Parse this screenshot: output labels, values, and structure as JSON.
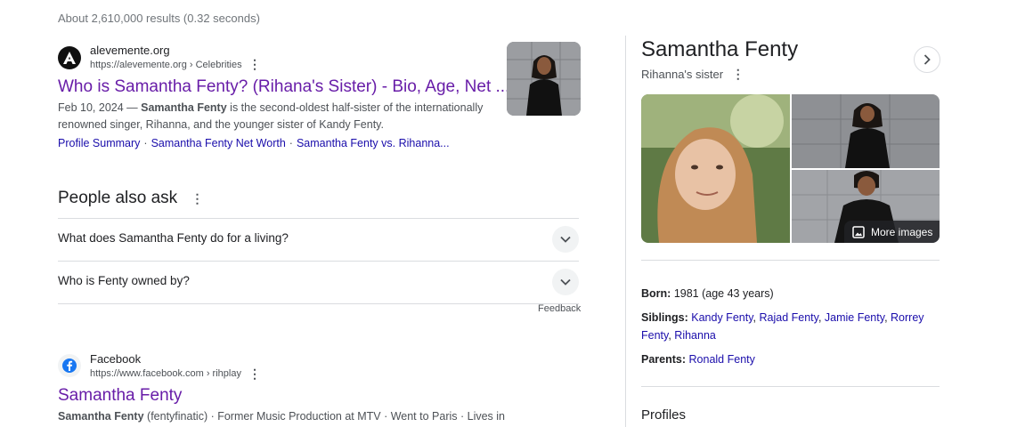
{
  "stats": "About 2,610,000 results (0.32 seconds)",
  "results": [
    {
      "site_name": "alevemente.org",
      "url": "https://alevemente.org › Celebrities",
      "title": "Who is Samantha Fenty? (Rihana's Sister) - Bio, Age, Net ...",
      "snippet_date": "Feb 10, 2024 — ",
      "snippet_bold": "Samantha Fenty",
      "snippet_rest": " is the second-oldest half-sister of the internationally renowned singer, Rihanna, and the younger sister of Kandy Fenty.",
      "sitelinks": [
        "Profile Summary",
        "Samantha Fenty Net Worth",
        "Samantha Fenty vs. Rihanna..."
      ]
    },
    {
      "site_name": "Facebook",
      "url": "https://www.facebook.com › rihplay",
      "title": "Samantha Fenty",
      "snippet_bold": "Samantha Fenty",
      "snippet_rest": " (fentyfinatic) · Former Music Production at MTV · Went to Paris · Lives in"
    }
  ],
  "paa": {
    "title": "People also ask",
    "questions": [
      "What does Samantha Fenty do for a living?",
      "Who is Fenty owned by?"
    ],
    "feedback": "Feedback"
  },
  "knowledge_panel": {
    "title": "Samantha Fenty",
    "subtitle": "Rihanna's sister",
    "more_images": "More images",
    "born_label": "Born:",
    "born_value": "1981 (age 43 years)",
    "siblings_label": "Siblings:",
    "siblings": [
      "Kandy Fenty",
      "Rajad Fenty",
      "Jamie Fenty",
      "Rorrey Fenty",
      "Rihanna"
    ],
    "parents_label": "Parents:",
    "parents": [
      "Ronald Fenty"
    ],
    "profiles_heading": "Profiles"
  },
  "colors": {
    "visited_link": "#681da8",
    "link": "#1a0dab",
    "text": "#202124",
    "muted": "#4d5156",
    "divider": "#dadce0"
  },
  "icons": [
    "kebab-icon",
    "chevron-down-icon",
    "chevron-right-icon",
    "image-icon",
    "facebook-icon"
  ]
}
